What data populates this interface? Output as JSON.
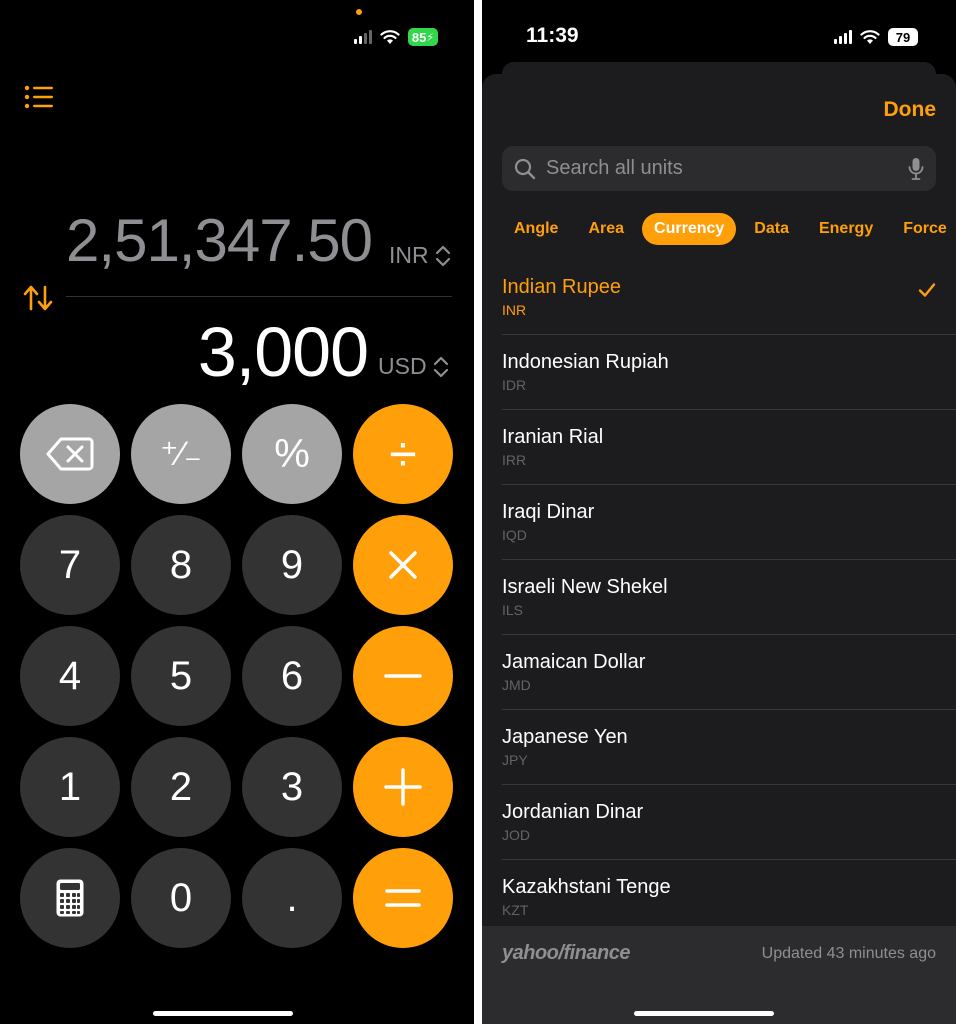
{
  "left": {
    "battery": "85",
    "secondary": {
      "value": "2,51,347.50",
      "unit": "INR"
    },
    "primary": {
      "value": "3,000",
      "unit": "USD"
    },
    "keys": {
      "plus_minus": "⁺∕₋",
      "percent": "%",
      "divide": "÷",
      "seven": "7",
      "eight": "8",
      "nine": "9",
      "four": "4",
      "five": "5",
      "six": "6",
      "one": "1",
      "two": "2",
      "three": "3",
      "zero": "0",
      "decimal": "."
    },
    "icons": {
      "list": "list-icon",
      "swap": "swap-arrows-icon",
      "backspace": "backspace-icon",
      "calculator": "calculator-icon",
      "multiply": "multiply-icon",
      "minus": "minus-icon",
      "plus": "plus-icon",
      "equals": "equals-icon"
    }
  },
  "right": {
    "time": "11:39",
    "battery": "79",
    "done": "Done",
    "search_placeholder": "Search all units",
    "tabs": [
      {
        "label": "Angle"
      },
      {
        "label": "Area"
      },
      {
        "label": "Currency"
      },
      {
        "label": "Data"
      },
      {
        "label": "Energy"
      },
      {
        "label": "Force"
      }
    ],
    "active_tab": "Currency",
    "currencies": [
      {
        "name": "Indian Rupee",
        "code": "INR"
      },
      {
        "name": "Indonesian Rupiah",
        "code": "IDR"
      },
      {
        "name": "Iranian Rial",
        "code": "IRR"
      },
      {
        "name": "Iraqi Dinar",
        "code": "IQD"
      },
      {
        "name": "Israeli New Shekel",
        "code": "ILS"
      },
      {
        "name": "Jamaican Dollar",
        "code": "JMD"
      },
      {
        "name": "Japanese Yen",
        "code": "JPY"
      },
      {
        "name": "Jordanian Dinar",
        "code": "JOD"
      },
      {
        "name": "Kazakhstani Tenge",
        "code": "KZT"
      }
    ],
    "selected_currency": "Indian Rupee",
    "footer": {
      "brand": "yahoo/finance",
      "updated": "Updated 43 minutes ago"
    }
  },
  "colors": {
    "accent": "#ff9f0a",
    "key_dark": "#333333",
    "key_light": "#a5a5a5",
    "sheet": "#1c1c1e",
    "battery_charging": "#32d74b"
  }
}
